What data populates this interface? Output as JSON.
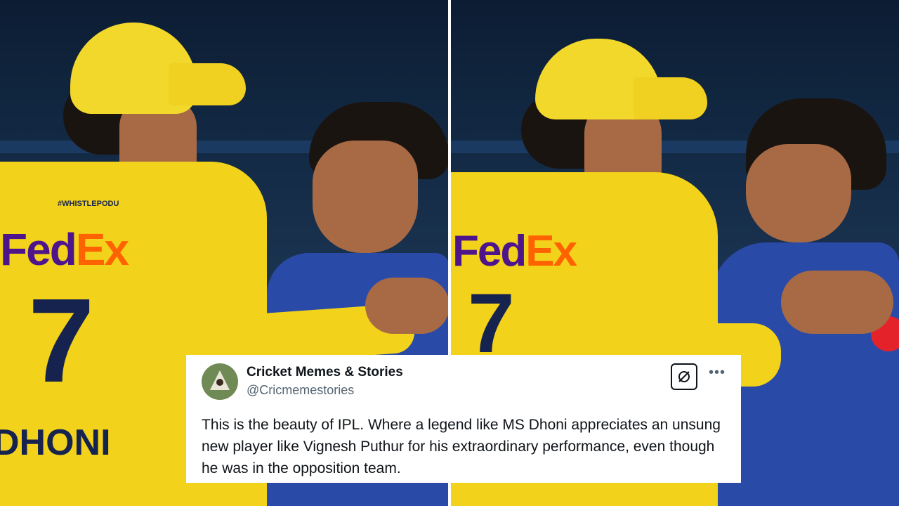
{
  "photo": {
    "left_panel": {
      "jersey_sponsor": "FedEx",
      "jersey_number": "7",
      "jersey_name": "DHONI",
      "tag": "#WHISTLEPODU"
    },
    "right_panel": {
      "jersey_sponsor": "FedEx",
      "jersey_number": "7"
    },
    "colors": {
      "csk_yellow": "#f2d21b",
      "mi_blue": "#2a4aa8",
      "fedex_purple": "#4d148c",
      "fedex_orange": "#ff6200"
    }
  },
  "tweet": {
    "name": "Cricket Memes & Stories",
    "handle": "@Cricmemestories",
    "text": "This is the beauty of IPL. Where a legend like MS Dhoni appreciates an unsung new player like Vignesh Puthur for his extraordinary performance, even though he was in the opposition team.",
    "icons": {
      "grok": "grok-icon",
      "more": "more-icon"
    }
  }
}
